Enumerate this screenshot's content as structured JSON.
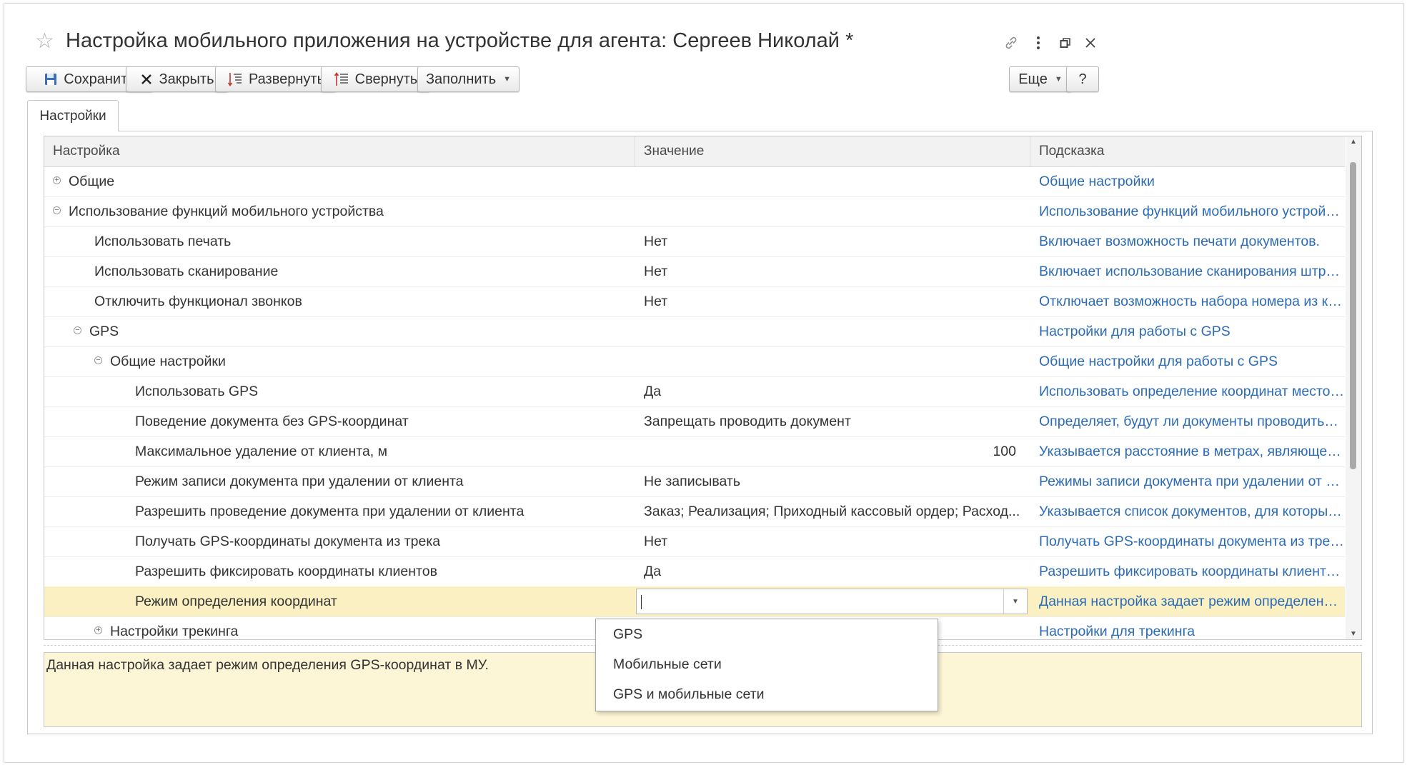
{
  "window": {
    "title": "Настройка мобильного приложения на устройстве для агента: Сергеев Николай *"
  },
  "toolbar": {
    "save_label": "Сохранить",
    "close_label": "Закрыть",
    "expand_label": "Развернуть",
    "collapse_label": "Свернуть",
    "fill_label": "Заполнить",
    "more_label": "Еще",
    "help_label": "?"
  },
  "tabs": [
    {
      "label": "Настройки"
    }
  ],
  "grid": {
    "columns": [
      "Настройка",
      "Значение",
      "Подсказка"
    ],
    "rows": [
      {
        "name": "Общие",
        "value": "",
        "hint": "Общие настройки",
        "expander": "plus"
      },
      {
        "name": "Использование функций мобильного устройства",
        "value": "",
        "hint": "Использование функций мобильного устройства",
        "expander": "minus"
      },
      {
        "name": "Использовать печать",
        "value": "Нет",
        "hint": "Включает возможность печати документов."
      },
      {
        "name": "Использовать сканирование",
        "value": "Нет",
        "hint": "Включает использование сканирования штрих-ко..."
      },
      {
        "name": "Отключить функционал звонков",
        "value": "Нет",
        "hint": "Отключает возможность набора номера из конте..."
      },
      {
        "name": "GPS",
        "value": "",
        "hint": "Настройки для работы с GPS",
        "expander": "minus"
      },
      {
        "name": "Общие настройки",
        "value": "",
        "hint": "Общие настройки для работы с GPS",
        "expander": "minus"
      },
      {
        "name": "Использовать GPS",
        "value": "Да",
        "hint": "Использовать определение координат местопол..."
      },
      {
        "name": "Поведение документа без GPS-координат",
        "value": "Запрещать проводить документ",
        "hint": "Определяет, будут ли документы проводиться, е..."
      },
      {
        "name": "Максимальное удаление от клиента, м",
        "value": "100",
        "hint": "Указывается расстояние в метрах, являющееся ..."
      },
      {
        "name": "Режим записи документа при удалении от клиента",
        "value": "Не записывать",
        "hint": "Режимы записи документа при удалении от клиен..."
      },
      {
        "name": "Разрешить проведение документа при удалении от клиента",
        "value": "Заказ; Реализация; Приходный кассовый ордер; Расход...",
        "hint": "Указывается список документов, для которых бу..."
      },
      {
        "name": "Получать GPS-координаты документа из трека",
        "value": "Нет",
        "hint": "Получать GPS-координаты документа из трека в..."
      },
      {
        "name": "Разрешить фиксировать координаты клиентов",
        "value": "Да",
        "hint": "Разрешить фиксировать координаты клиентов п..."
      },
      {
        "name": "Режим определения координат",
        "value": "",
        "hint": "Данная настройка задает режим определения G...",
        "selected": true
      },
      {
        "name": "Настройки трекинга",
        "value": "",
        "hint": "Настройки для трекинга",
        "expander": "plus"
      }
    ]
  },
  "dropdown": {
    "options": [
      "GPS",
      "Мобильные сети",
      "GPS и мобильные сети"
    ]
  },
  "description": {
    "text": "Данная настройка задает режим определения GPS-координат в МУ."
  },
  "colors": {
    "link": "#2d6bb5",
    "selected_row": "#fbf0c2",
    "description_bg": "#fdf6d6"
  },
  "icons": [
    "star-icon",
    "link-icon",
    "more-vertical-icon",
    "restore-window-icon",
    "close-icon",
    "save-icon",
    "close-x-icon",
    "expand-tree-icon",
    "collapse-tree-icon"
  ]
}
